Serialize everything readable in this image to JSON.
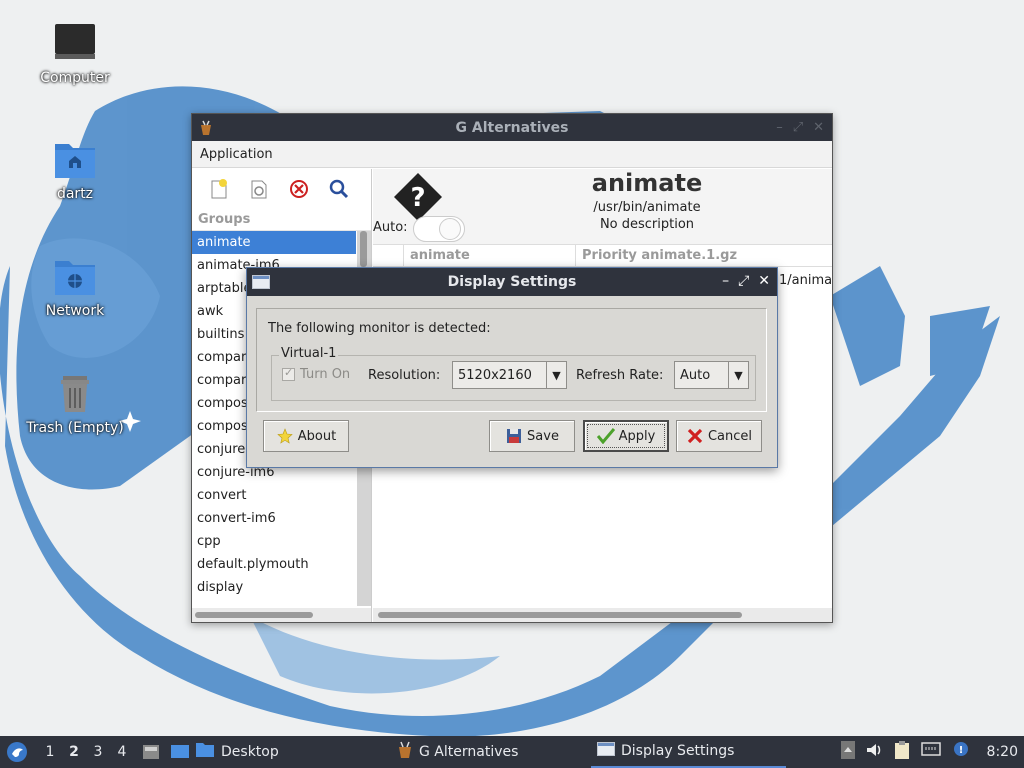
{
  "desktop": {
    "icons": [
      {
        "label": "Computer",
        "icon": "computer-icon"
      },
      {
        "label": "dartz",
        "icon": "home-folder-icon"
      },
      {
        "label": "Network",
        "icon": "network-folder-icon"
      },
      {
        "label": "Trash (Empty)",
        "icon": "trash-icon"
      }
    ]
  },
  "main_window": {
    "title": "G Alternatives",
    "menu": [
      "Application"
    ],
    "toolbar": [
      "new-icon",
      "properties-icon",
      "delete-icon",
      "search-icon"
    ],
    "groups_header": "Groups",
    "groups": [
      "animate",
      "animate-im6",
      "arptables",
      "awk",
      "builtins",
      "compare",
      "compare-im6",
      "composite",
      "composite-im6",
      "conjure",
      "conjure-im6",
      "convert",
      "convert-im6",
      "cpp",
      "default.plymouth",
      "display"
    ],
    "selected_group": "animate",
    "alternative": {
      "name": "animate",
      "path": "/usr/bin/animate",
      "description": "No description",
      "auto_label": "Auto:"
    },
    "columns": [
      "",
      "animate",
      "Priority   animate.1.gz"
    ],
    "row_partial": "1/anima"
  },
  "dialog": {
    "title": "Display Settings",
    "detected_text": "The following monitor is detected:",
    "monitor_name": "Virtual-1",
    "turn_on_label": "Turn On",
    "turn_on_checked": true,
    "resolution_label": "Resolution:",
    "resolution_value": "5120x2160",
    "refresh_label": "Refresh Rate:",
    "refresh_value": "Auto",
    "buttons": {
      "about": "About",
      "save": "Save",
      "apply": "Apply",
      "cancel": "Cancel"
    }
  },
  "taskbar": {
    "workspaces": [
      "1",
      "2",
      "3",
      "4"
    ],
    "active_workspace": "2",
    "tasks": [
      {
        "label": "Desktop",
        "icon": "folder-icon"
      },
      {
        "label": "G Alternatives",
        "icon": "galternatives-icon"
      },
      {
        "label": "Display Settings",
        "icon": "window-icon"
      }
    ],
    "clock": "8:20"
  },
  "colors": {
    "titlebar": "#2f333d",
    "selection": "#3d80d6",
    "dialog_bg": "#d9d8d4",
    "wallpaper_blue": "#3f7fc0"
  }
}
